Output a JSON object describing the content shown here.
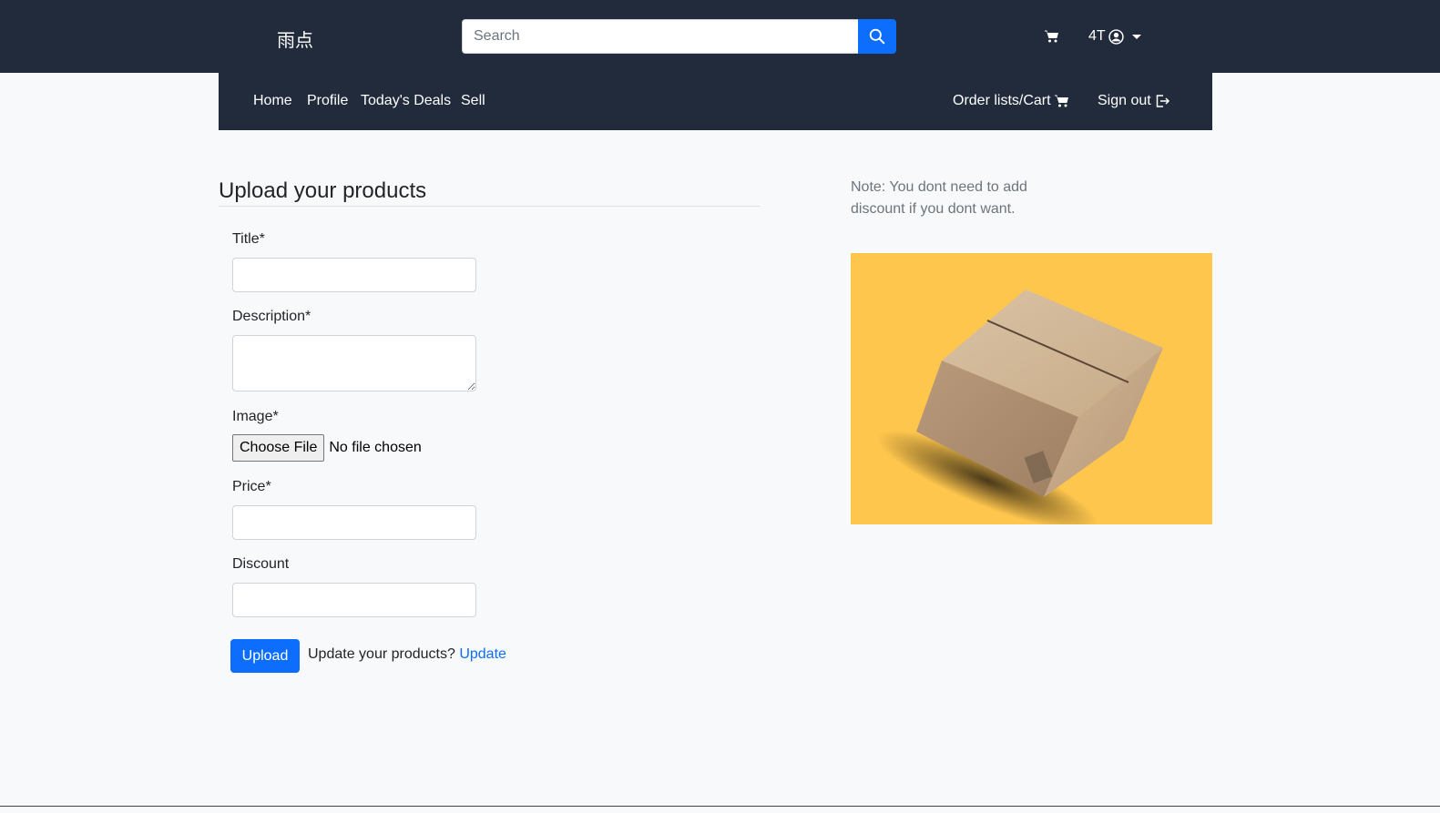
{
  "header": {
    "brand": "雨点",
    "search": {
      "placeholder": "Search",
      "value": ""
    },
    "user_label": "4T"
  },
  "nav": {
    "home": "Home",
    "profile": "Profile",
    "deals": "Today's Deals",
    "sell": "Sell",
    "orders": "Order lists/Cart",
    "signout": "Sign out"
  },
  "form": {
    "heading": "Upload your products",
    "title_label": "Title*",
    "title_value": "",
    "description_label": "Description*",
    "description_value": "",
    "image_label": "Image*",
    "file_button": "Choose File",
    "file_status": "No file chosen",
    "price_label": "Price*",
    "price_value": "",
    "discount_label": "Discount",
    "discount_value": "",
    "upload_button": "Upload",
    "update_prompt": "Update your products?",
    "update_link": "Update"
  },
  "sidebar": {
    "note": "Note: You dont need to add discount if you dont want.",
    "image_icon": "cardboard-box-image"
  },
  "colors": {
    "navbar": "#212b3c",
    "primary": "#0d6efd",
    "page_bg": "#f8f9fa",
    "image_bg": "#fec64d"
  }
}
